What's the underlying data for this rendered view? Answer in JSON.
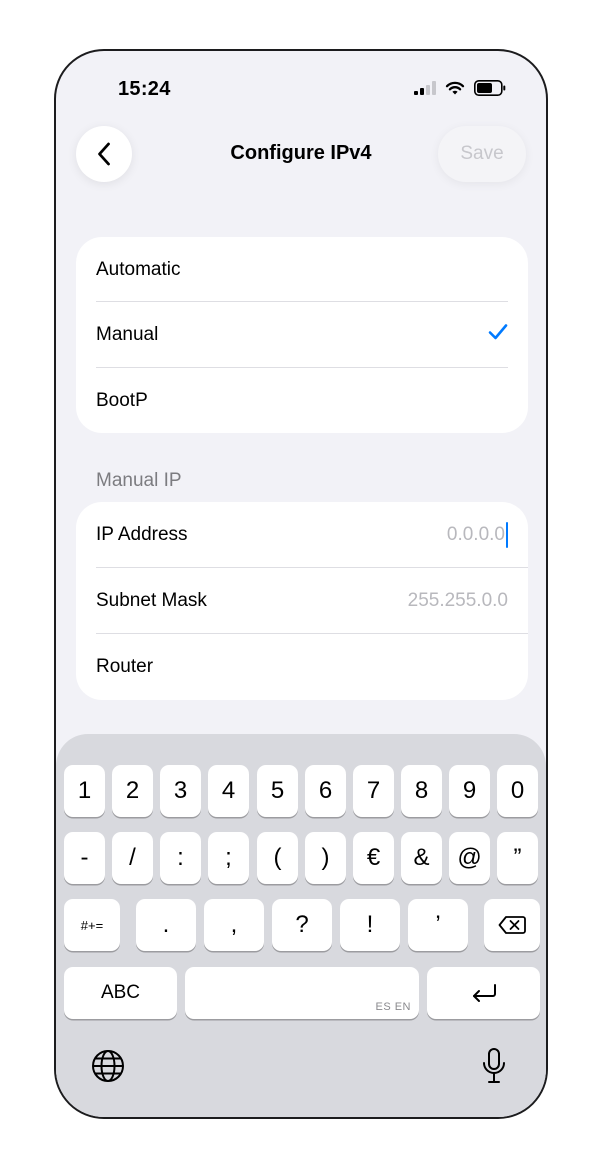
{
  "status": {
    "time": "15:24"
  },
  "nav": {
    "title": "Configure IPv4",
    "save_label": "Save"
  },
  "mode_options": [
    {
      "label": "Automatic",
      "selected": false
    },
    {
      "label": "Manual",
      "selected": true
    },
    {
      "label": "BootP",
      "selected": false
    }
  ],
  "manual_ip": {
    "header": "Manual IP",
    "fields": [
      {
        "label": "IP Address",
        "placeholder": "0.0.0.0"
      },
      {
        "label": "Subnet Mask",
        "placeholder": "255.255.0.0"
      },
      {
        "label": "Router",
        "placeholder": ""
      }
    ]
  },
  "keyboard": {
    "row1": [
      "1",
      "2",
      "3",
      "4",
      "5",
      "6",
      "7",
      "8",
      "9",
      "0"
    ],
    "row2": [
      "-",
      "/",
      ":",
      ";",
      "(",
      ")",
      "€",
      "&",
      "@",
      "”"
    ],
    "row3_mode": "#+=",
    "row3": [
      ".",
      ",",
      "?",
      "!",
      "’"
    ],
    "abc_label": "ABC",
    "space_lang": "ES EN"
  },
  "colors": {
    "accent": "#007aff",
    "background": "#f2f2f7",
    "keyboard_bg": "#d8d9de"
  }
}
